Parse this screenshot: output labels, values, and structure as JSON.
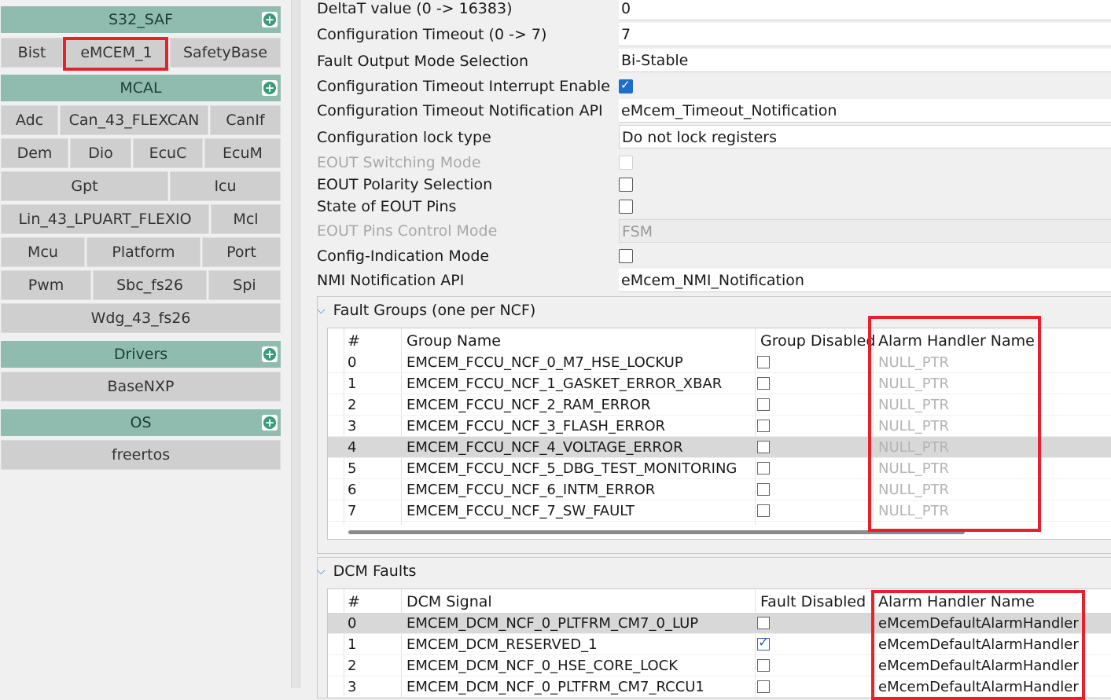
{
  "left_panel": {
    "groups": [
      {
        "title": "S32_SAF",
        "buttons": [
          "Bist",
          "eMCEM_1",
          "SafetyBase"
        ]
      },
      {
        "title": "MCAL",
        "buttons": [
          "Adc",
          "Can_43_FLEXCAN",
          "CanIf",
          "Dem",
          "Dio",
          "EcuC",
          "EcuM",
          "Gpt",
          "Icu",
          "Lin_43_LPUART_FLEXIO",
          "Mcl",
          "Mcu",
          "Platform",
          "Port",
          "Pwm",
          "Sbc_fs26",
          "Spi",
          "Wdg_43_fs26"
        ]
      },
      {
        "title": "Drivers",
        "buttons": [
          "BaseNXP"
        ]
      },
      {
        "title": "OS",
        "buttons": [
          "freertos"
        ]
      }
    ],
    "add_icon": "plus-circle-icon"
  },
  "properties": [
    {
      "label": "DeltaT value (0 -> 16383)",
      "type": "text",
      "value": "0"
    },
    {
      "label": "Configuration Timeout (0 -> 7)",
      "type": "text",
      "value": "7"
    },
    {
      "label": "Fault Output Mode Selection",
      "type": "select",
      "value": "Bi-Stable"
    },
    {
      "label": "Configuration Timeout Interrupt Enable",
      "type": "checkbox",
      "checked": true
    },
    {
      "label": "Configuration Timeout Notification API",
      "type": "text",
      "value": "eMcem_Timeout_Notification"
    },
    {
      "label": "Configuration lock type",
      "type": "select",
      "value": "Do not lock registers"
    },
    {
      "label": "EOUT Switching Mode",
      "type": "checkbox",
      "checked": false,
      "disabled": true
    },
    {
      "label": "EOUT Polarity Selection",
      "type": "checkbox",
      "checked": false
    },
    {
      "label": "State of EOUT Pins",
      "type": "checkbox",
      "checked": false
    },
    {
      "label": "EOUT Pins Control Mode",
      "type": "select",
      "value": "FSM",
      "disabled": true
    },
    {
      "label": "Config-Indication Mode",
      "type": "checkbox",
      "checked": false
    },
    {
      "label": "NMI Notification API",
      "type": "text",
      "value": "eMcem_NMI_Notification"
    }
  ],
  "fault_groups": {
    "title": "Fault Groups (one per NCF)",
    "columns": [
      "#",
      "Group Name",
      "Group Disabled",
      "Alarm Handler Name"
    ],
    "rows": [
      {
        "idx": "0",
        "name": "EMCEM_FCCU_NCF_0_M7_HSE_LOCKUP",
        "disabled": false,
        "handler": "NULL_PTR"
      },
      {
        "idx": "1",
        "name": "EMCEM_FCCU_NCF_1_GASKET_ERROR_XBAR",
        "disabled": false,
        "handler": "NULL_PTR"
      },
      {
        "idx": "2",
        "name": "EMCEM_FCCU_NCF_2_RAM_ERROR",
        "disabled": false,
        "handler": "NULL_PTR"
      },
      {
        "idx": "3",
        "name": "EMCEM_FCCU_NCF_3_FLASH_ERROR",
        "disabled": false,
        "handler": "NULL_PTR"
      },
      {
        "idx": "4",
        "name": "EMCEM_FCCU_NCF_4_VOLTAGE_ERROR",
        "disabled": false,
        "handler": "NULL_PTR"
      },
      {
        "idx": "5",
        "name": "EMCEM_FCCU_NCF_5_DBG_TEST_MONITORING",
        "disabled": false,
        "handler": "NULL_PTR"
      },
      {
        "idx": "6",
        "name": "EMCEM_FCCU_NCF_6_INTM_ERROR",
        "disabled": false,
        "handler": "NULL_PTR"
      },
      {
        "idx": "7",
        "name": "EMCEM_FCCU_NCF_7_SW_FAULT",
        "disabled": false,
        "handler": "NULL_PTR"
      }
    ]
  },
  "dcm_faults": {
    "title": "DCM Faults",
    "columns": [
      "#",
      "DCM Signal",
      "Fault Disabled",
      "Alarm Handler Name"
    ],
    "rows": [
      {
        "idx": "0",
        "name": "EMCEM_DCM_NCF_0_PLTFRM_CM7_0_LUP",
        "disabled": false,
        "handler": "eMcemDefaultAlarmHandler"
      },
      {
        "idx": "1",
        "name": "EMCEM_DCM_RESERVED_1",
        "disabled": true,
        "handler": "eMcemDefaultAlarmHandler"
      },
      {
        "idx": "2",
        "name": "EMCEM_DCM_NCF_0_HSE_CORE_LOCK",
        "disabled": false,
        "handler": "eMcemDefaultAlarmHandler"
      },
      {
        "idx": "3",
        "name": "EMCEM_DCM_NCF_0_PLTFRM_CM7_RCCU1",
        "disabled": false,
        "handler": "eMcemDefaultAlarmHandler"
      }
    ]
  },
  "colors": {
    "group_header": "#8fbcaf",
    "highlight": "#e8202a",
    "checkbox_accent": "#1e6fc9"
  }
}
